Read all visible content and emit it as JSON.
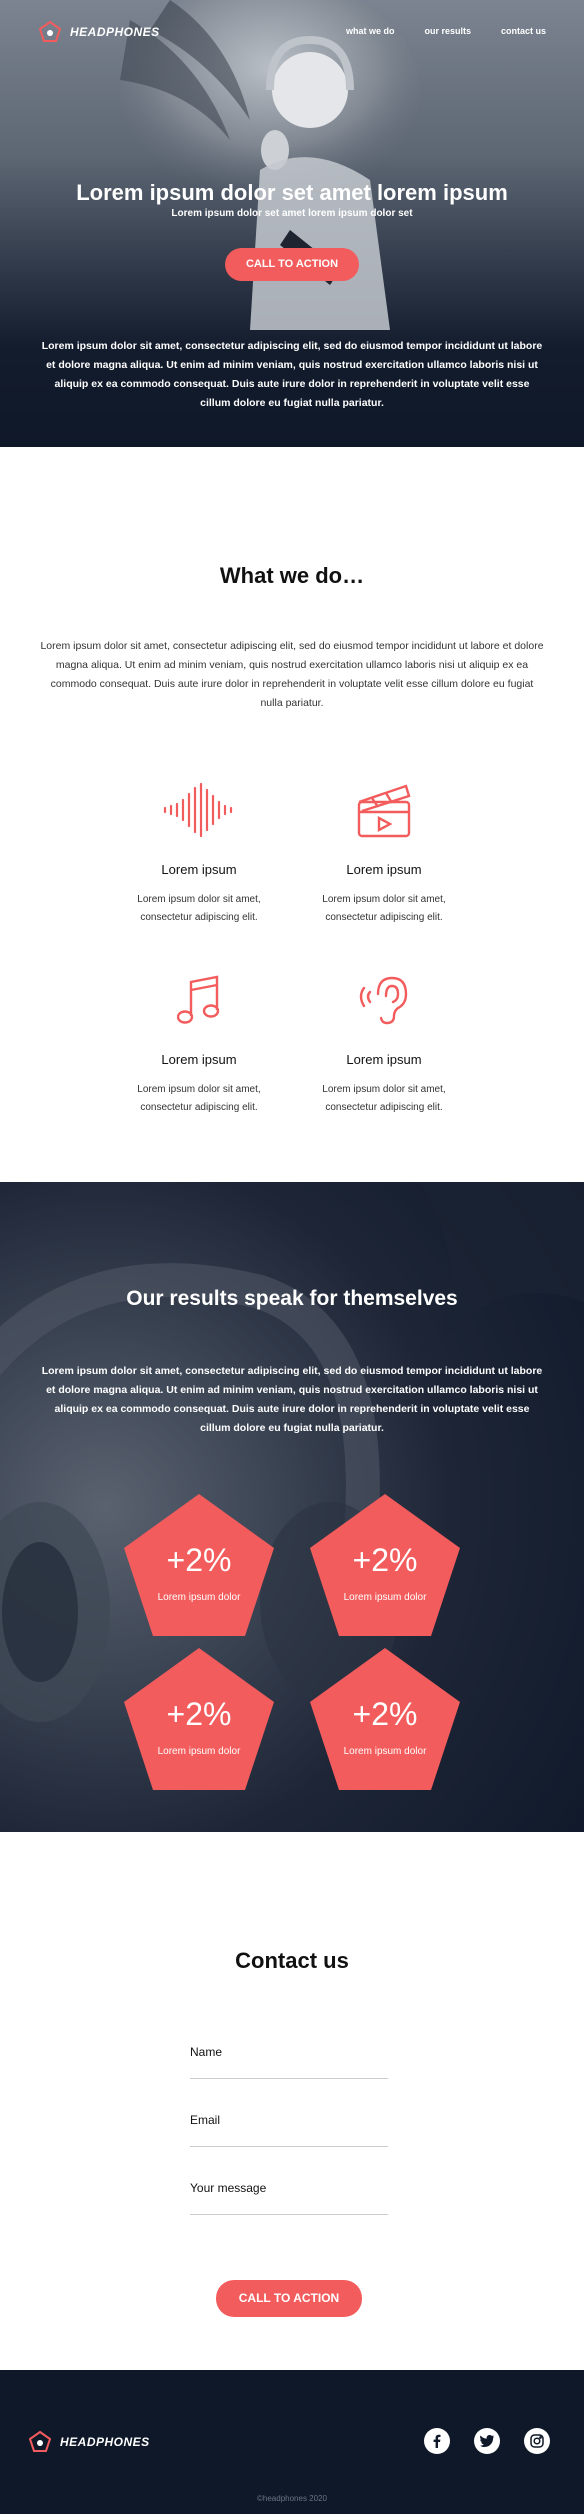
{
  "brand": {
    "name": "HEADPHONES",
    "accent": "#f35c5c",
    "dark": "#0e1828"
  },
  "nav": {
    "items": [
      "what we do",
      "our results",
      "contact us"
    ]
  },
  "hero": {
    "title": "Lorem ipsum dolor set amet lorem ipsum",
    "subtitle": "Lorem ipsum dolor set amet lorem ipsum dolor set",
    "cta": "CALL TO ACTION",
    "text": "Lorem ipsum dolor sit amet, consectetur adipiscing elit, sed do eiusmod tempor incididunt ut labore et dolore magna aliqua. Ut enim ad minim veniam, quis nostrud exercitation ullamco laboris nisi ut aliquip ex ea commodo consequat. Duis aute irure dolor in reprehenderit in voluptate velit esse cillum dolore eu fugiat nulla pariatur."
  },
  "what_we_do": {
    "title": "What we do…",
    "text": "Lorem ipsum dolor sit amet, consectetur adipiscing elit, sed do eiusmod tempor incididunt ut labore et dolore magna aliqua. Ut enim ad minim veniam, quis nostrud exercitation ullamco laboris nisi ut aliquip ex ea commodo consequat. Duis aute irure dolor in reprehenderit in voluptate velit esse cillum dolore eu fugiat nulla pariatur.",
    "features": [
      {
        "icon": "sound-wave-icon",
        "title": "Lorem ipsum",
        "desc": "Lorem ipsum dolor sit amet, consectetur adipiscing elit."
      },
      {
        "icon": "clapperboard-icon",
        "title": "Lorem ipsum",
        "desc": "Lorem ipsum dolor sit amet, consectetur adipiscing elit."
      },
      {
        "icon": "music-note-icon",
        "title": "Lorem ipsum",
        "desc": "Lorem ipsum dolor sit amet, consectetur adipiscing elit."
      },
      {
        "icon": "ear-icon",
        "title": "Lorem ipsum",
        "desc": "Lorem ipsum dolor sit amet, consectetur adipiscing elit."
      }
    ]
  },
  "results": {
    "title": "Our results speak for themselves",
    "text": "Lorem ipsum dolor sit amet, consectetur adipiscing elit, sed do eiusmod tempor incididunt ut labore et dolore magna aliqua. Ut enim ad minim veniam, quis nostrud exercitation ullamco laboris nisi ut aliquip ex ea commodo consequat. Duis aute irure dolor in reprehenderit in voluptate velit esse cillum dolore eu fugiat nulla pariatur.",
    "stats": [
      {
        "value": "+2%",
        "label": "Lorem ipsum dolor"
      },
      {
        "value": "+2%",
        "label": "Lorem ipsum dolor"
      },
      {
        "value": "+2%",
        "label": "Lorem ipsum dolor"
      },
      {
        "value": "+2%",
        "label": "Lorem ipsum dolor"
      }
    ]
  },
  "contact": {
    "title": "Contact us",
    "fields": [
      "Name",
      "Email",
      "Your message"
    ],
    "cta": "CALL TO ACTION"
  },
  "footer": {
    "socials": [
      "facebook-icon",
      "twitter-icon",
      "instagram-icon"
    ],
    "copyright": "©headphones 2020"
  }
}
